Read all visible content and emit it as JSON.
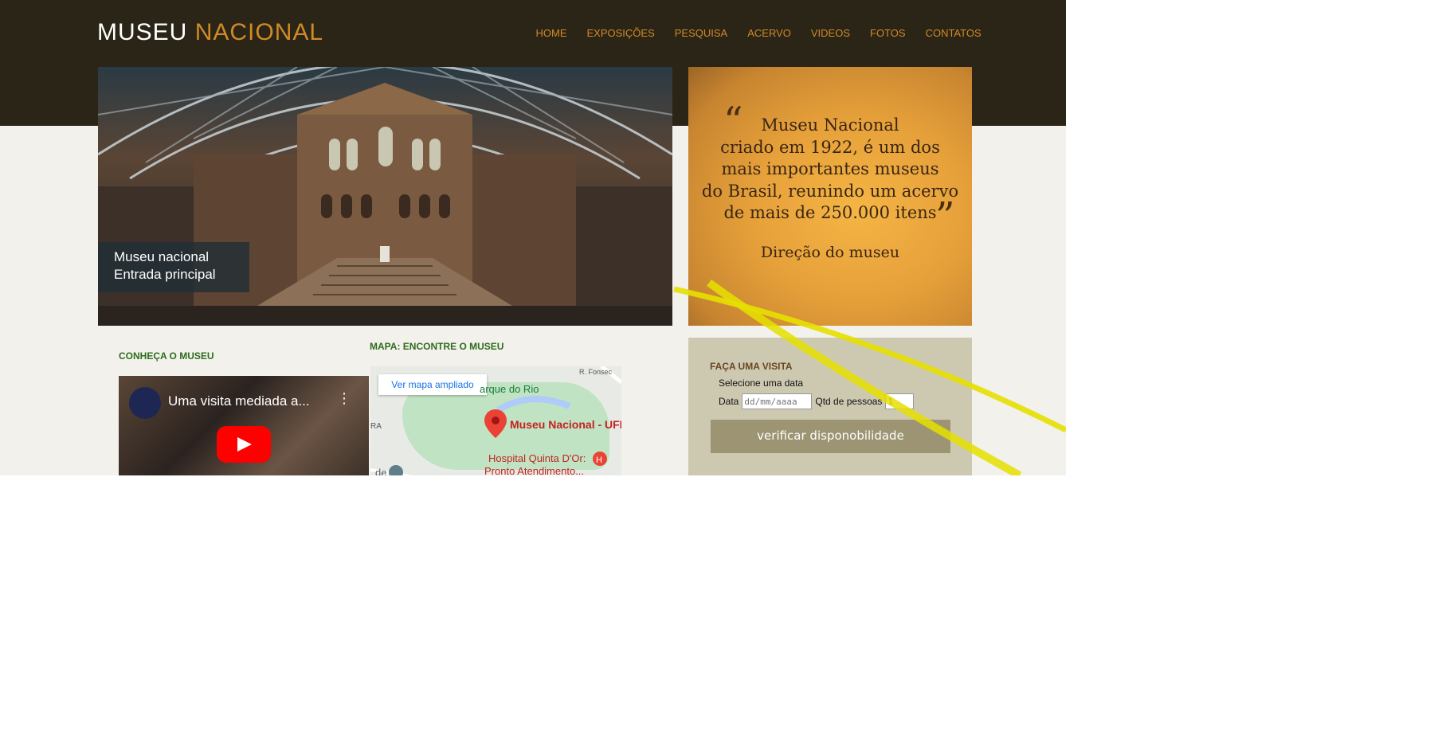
{
  "header": {
    "logo_part1": "MUSEU",
    "logo_part2": "NACIONAL",
    "nav": [
      "HOME",
      "EXPOSIÇÕES",
      "PESQUISA",
      "ACERVO",
      "VIDEOS",
      "FOTOS",
      "CONTATOS"
    ]
  },
  "hero": {
    "caption_line1": "Museu nacional",
    "caption_line2": "Entrada principal"
  },
  "quote": {
    "open_mark": "“",
    "close_mark": "”",
    "lines": [
      "Museu Nacional",
      "criado em 1922, é um dos",
      "mais importantes museus",
      "do Brasil, reunindo um acervo",
      "de mais de 250.000 itens"
    ],
    "signature": "Direção do museu"
  },
  "sections": {
    "conheca": "CONHEÇA O MUSEU",
    "mapa": "MAPA: ENCONTRE O MUSEU"
  },
  "video": {
    "title": "Uma visita mediada a..."
  },
  "map": {
    "ver_mapa": "Ver mapa ampliado",
    "label_park": "arque do Rio",
    "label_museu": "Museu Nacional - UFR.",
    "label_hospital1": "Hospital Quinta D'Or:",
    "label_hospital2": "Pronto Atendimento...",
    "label_fonseca": "R. Fonsec",
    "label_ra": "RA",
    "label_de": "de"
  },
  "visit": {
    "title": "FAÇA UMA VISITA",
    "select_label": "Selecione uma data",
    "data_label": "Data",
    "date_placeholder": "dd/mm/aaaa",
    "qtd_label": "Qtd de pessoas",
    "qtd_value": "1",
    "button": "verificar disponobilidade"
  },
  "colors": {
    "header_bg": "#2b2518",
    "accent": "#d08a25",
    "page_bg": "#f2f1ec",
    "section_green": "#2f6b1d",
    "visit_bg": "#cdc9b1",
    "button_bg": "#9c9472",
    "stripe_yellow": "#e5e000"
  }
}
